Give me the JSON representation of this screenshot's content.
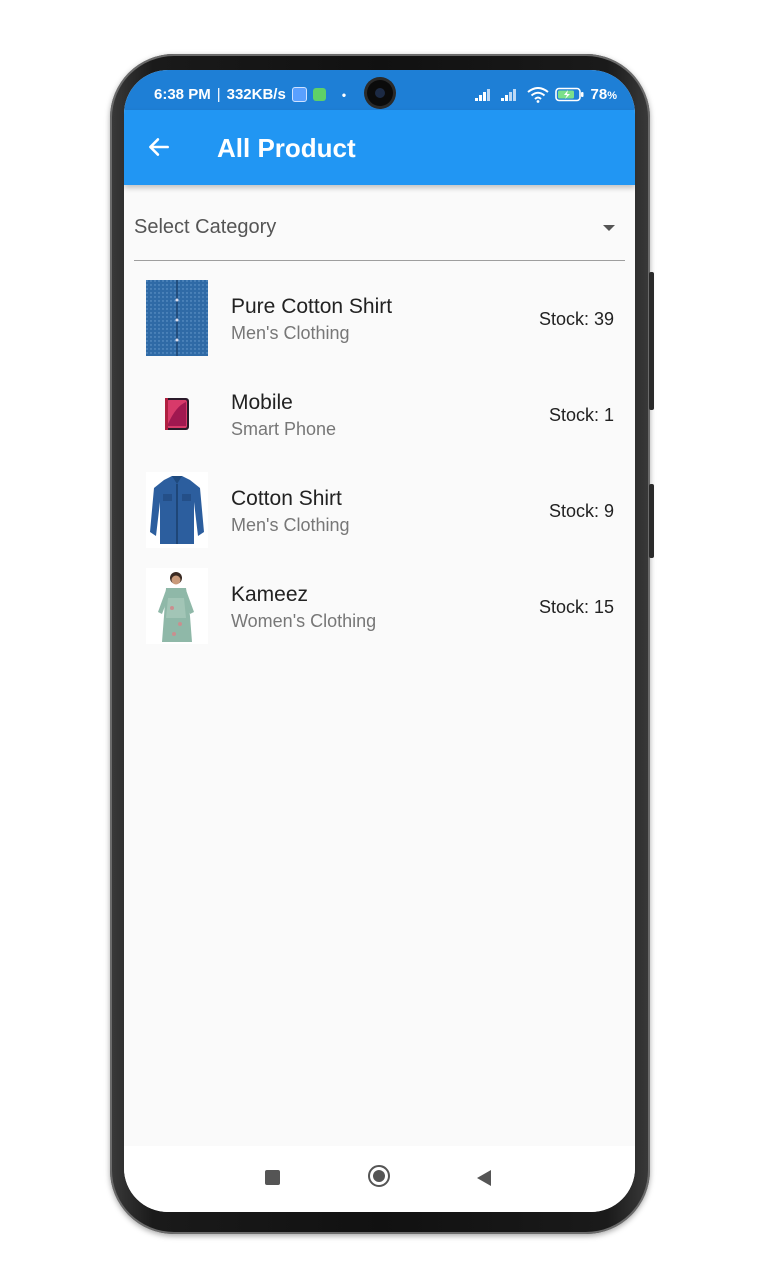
{
  "status_bar": {
    "time": "6:38 PM",
    "speed": "332KB/s",
    "battery": "78",
    "battery_unit": "%"
  },
  "app_bar": {
    "title": "All Product",
    "back_icon": "arrow-left-icon"
  },
  "filter": {
    "label": "Select Category",
    "icon": "caret-down-icon"
  },
  "products": [
    {
      "name": "Pure Cotton Shirt",
      "category": "Men's Clothing",
      "stock": "Stock: 39",
      "image": "blue-fabric-shirt-image"
    },
    {
      "name": "Mobile",
      "category": "Smart Phone",
      "stock": "Stock: 1",
      "image": "smartphone-image"
    },
    {
      "name": "Cotton Shirt",
      "category": "Men's Clothing",
      "stock": "Stock: 9",
      "image": "blue-denim-shirt-image"
    },
    {
      "name": "Kameez",
      "category": "Women's Clothing",
      "stock": "Stock: 15",
      "image": "woman-kameez-image"
    }
  ],
  "nav_bar": {
    "recents_icon": "square-icon",
    "home_icon": "circle-icon",
    "back_icon": "triangle-back-icon"
  },
  "colors": {
    "app_bar": "#2196f3",
    "status_bar": "#1e7fd6",
    "background": "#fafafa"
  }
}
